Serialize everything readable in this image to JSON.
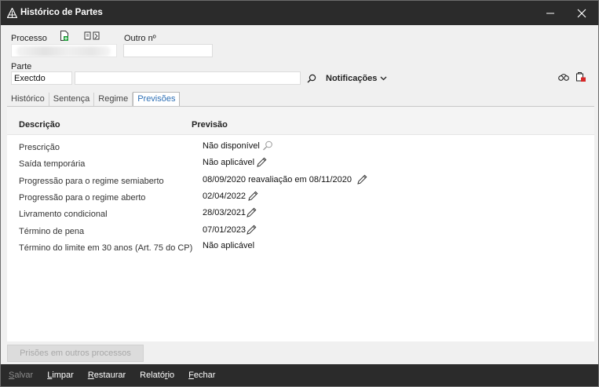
{
  "window": {
    "title": "Histórico de Partes"
  },
  "form": {
    "processo_label": "Processo",
    "outro_label": "Outro nº",
    "outro_value": "",
    "parte_label": "Parte",
    "parte_value": "Exectdo",
    "parte_name_value": "",
    "notificacoes_label": "Notificações"
  },
  "tabs": [
    {
      "label": "Histórico",
      "active": false
    },
    {
      "label": "Sentença",
      "active": false
    },
    {
      "label": "Regime",
      "active": false
    },
    {
      "label": "Previsões",
      "active": true
    }
  ],
  "table": {
    "col_descricao": "Descrição",
    "col_previsao": "Previsão",
    "rows": [
      {
        "descricao": "Prescrição",
        "previsao": "Não disponível",
        "icon": "search-icon"
      },
      {
        "descricao": "Saída temporária",
        "previsao": "Não aplicável",
        "icon": "pencil-icon"
      },
      {
        "descricao": "Progressão para o regime semiaberto",
        "previsao": "08/09/2020 reavaliação em 08/11/2020",
        "icon": "pencil-icon"
      },
      {
        "descricao": "Progressão para o regime aberto",
        "previsao": "02/04/2022",
        "icon": "pencil-icon"
      },
      {
        "descricao": "Livramento condicional",
        "previsao": "28/03/2021",
        "icon": "pencil-icon"
      },
      {
        "descricao": "Término de pena",
        "previsao": "07/01/2023",
        "icon": "pencil-icon"
      },
      {
        "descricao": "Término do limite em 30 anos (Art. 75 do CP)",
        "previsao": "Não aplicável",
        "icon": ""
      }
    ]
  },
  "buttons": {
    "prisoes": "Prisões em outros processos"
  },
  "footer": {
    "salvar": {
      "first": "S",
      "rest": "alvar",
      "disabled": true
    },
    "limpar": {
      "first": "L",
      "rest": "impar"
    },
    "restaurar": {
      "first": "R",
      "rest": "estaurar"
    },
    "relatorio_pre": "Relató",
    "relatorio_u": "r",
    "relatorio_post": "io",
    "fechar": {
      "first": "F",
      "rest": "echar"
    }
  },
  "colors": {
    "titlebar": "#2b2b2b",
    "active_tab_text": "#2d6fb5",
    "footer": "#2b2b2b"
  }
}
